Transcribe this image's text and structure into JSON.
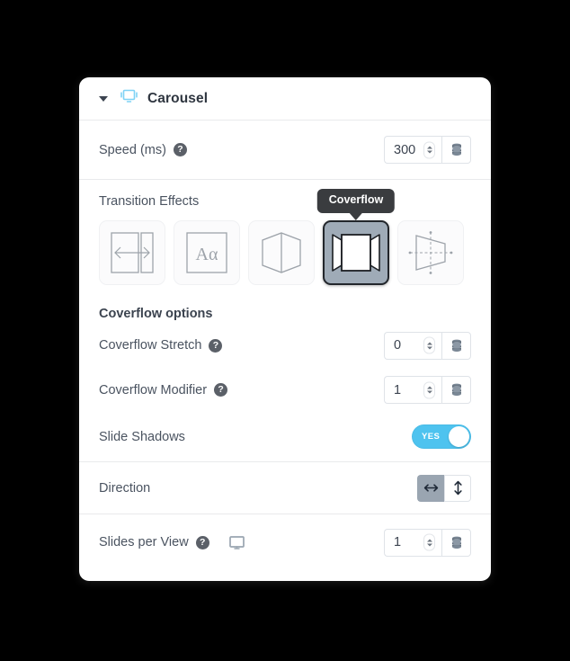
{
  "panel": {
    "header": {
      "title": "Carousel",
      "collapse_icon": "caret-down-icon",
      "module_icon": "carousel-icon"
    },
    "rows": {
      "speed": {
        "label": "Speed (ms)",
        "help_glyph": "?",
        "value": "300",
        "db_icon": "database-icon"
      },
      "transition_effects": {
        "label": "Transition Effects",
        "tooltip": "Coverflow",
        "items": [
          {
            "name": "slide",
            "icon": "slide-effect-icon",
            "selected": false
          },
          {
            "name": "fade",
            "icon": "fade-effect-icon",
            "glyph": "Aα",
            "selected": false
          },
          {
            "name": "cube",
            "icon": "cube-effect-icon",
            "selected": false
          },
          {
            "name": "coverflow",
            "icon": "coverflow-effect-icon",
            "selected": true
          },
          {
            "name": "flip",
            "icon": "flip-effect-icon",
            "selected": false
          }
        ]
      },
      "coverflow_options_title": "Coverflow options",
      "coverflow_stretch": {
        "label": "Coverflow Stretch",
        "help_glyph": "?",
        "value": "0",
        "db_icon": "database-icon"
      },
      "coverflow_modifier": {
        "label": "Coverflow Modifier",
        "help_glyph": "?",
        "value": "1",
        "db_icon": "database-icon"
      },
      "slide_shadows": {
        "label": "Slide Shadows",
        "toggle_state": "YES"
      },
      "direction": {
        "label": "Direction",
        "options": [
          {
            "name": "horizontal",
            "icon": "arrows-horizontal-icon",
            "selected": true
          },
          {
            "name": "vertical",
            "icon": "arrows-vertical-icon",
            "selected": false
          }
        ]
      },
      "slides_per_view": {
        "label": "Slides per View",
        "help_glyph": "?",
        "device_icon": "desktop-icon",
        "value": "1",
        "db_icon": "database-icon"
      }
    }
  },
  "colors": {
    "accent_blue": "#4ec3ef",
    "module_icon_blue": "#7fd2f5",
    "selected_swatch": "#9fabb7",
    "tooltip_bg": "#3a3c3f",
    "label_text": "#4a5360",
    "page_bg": "#000000"
  }
}
